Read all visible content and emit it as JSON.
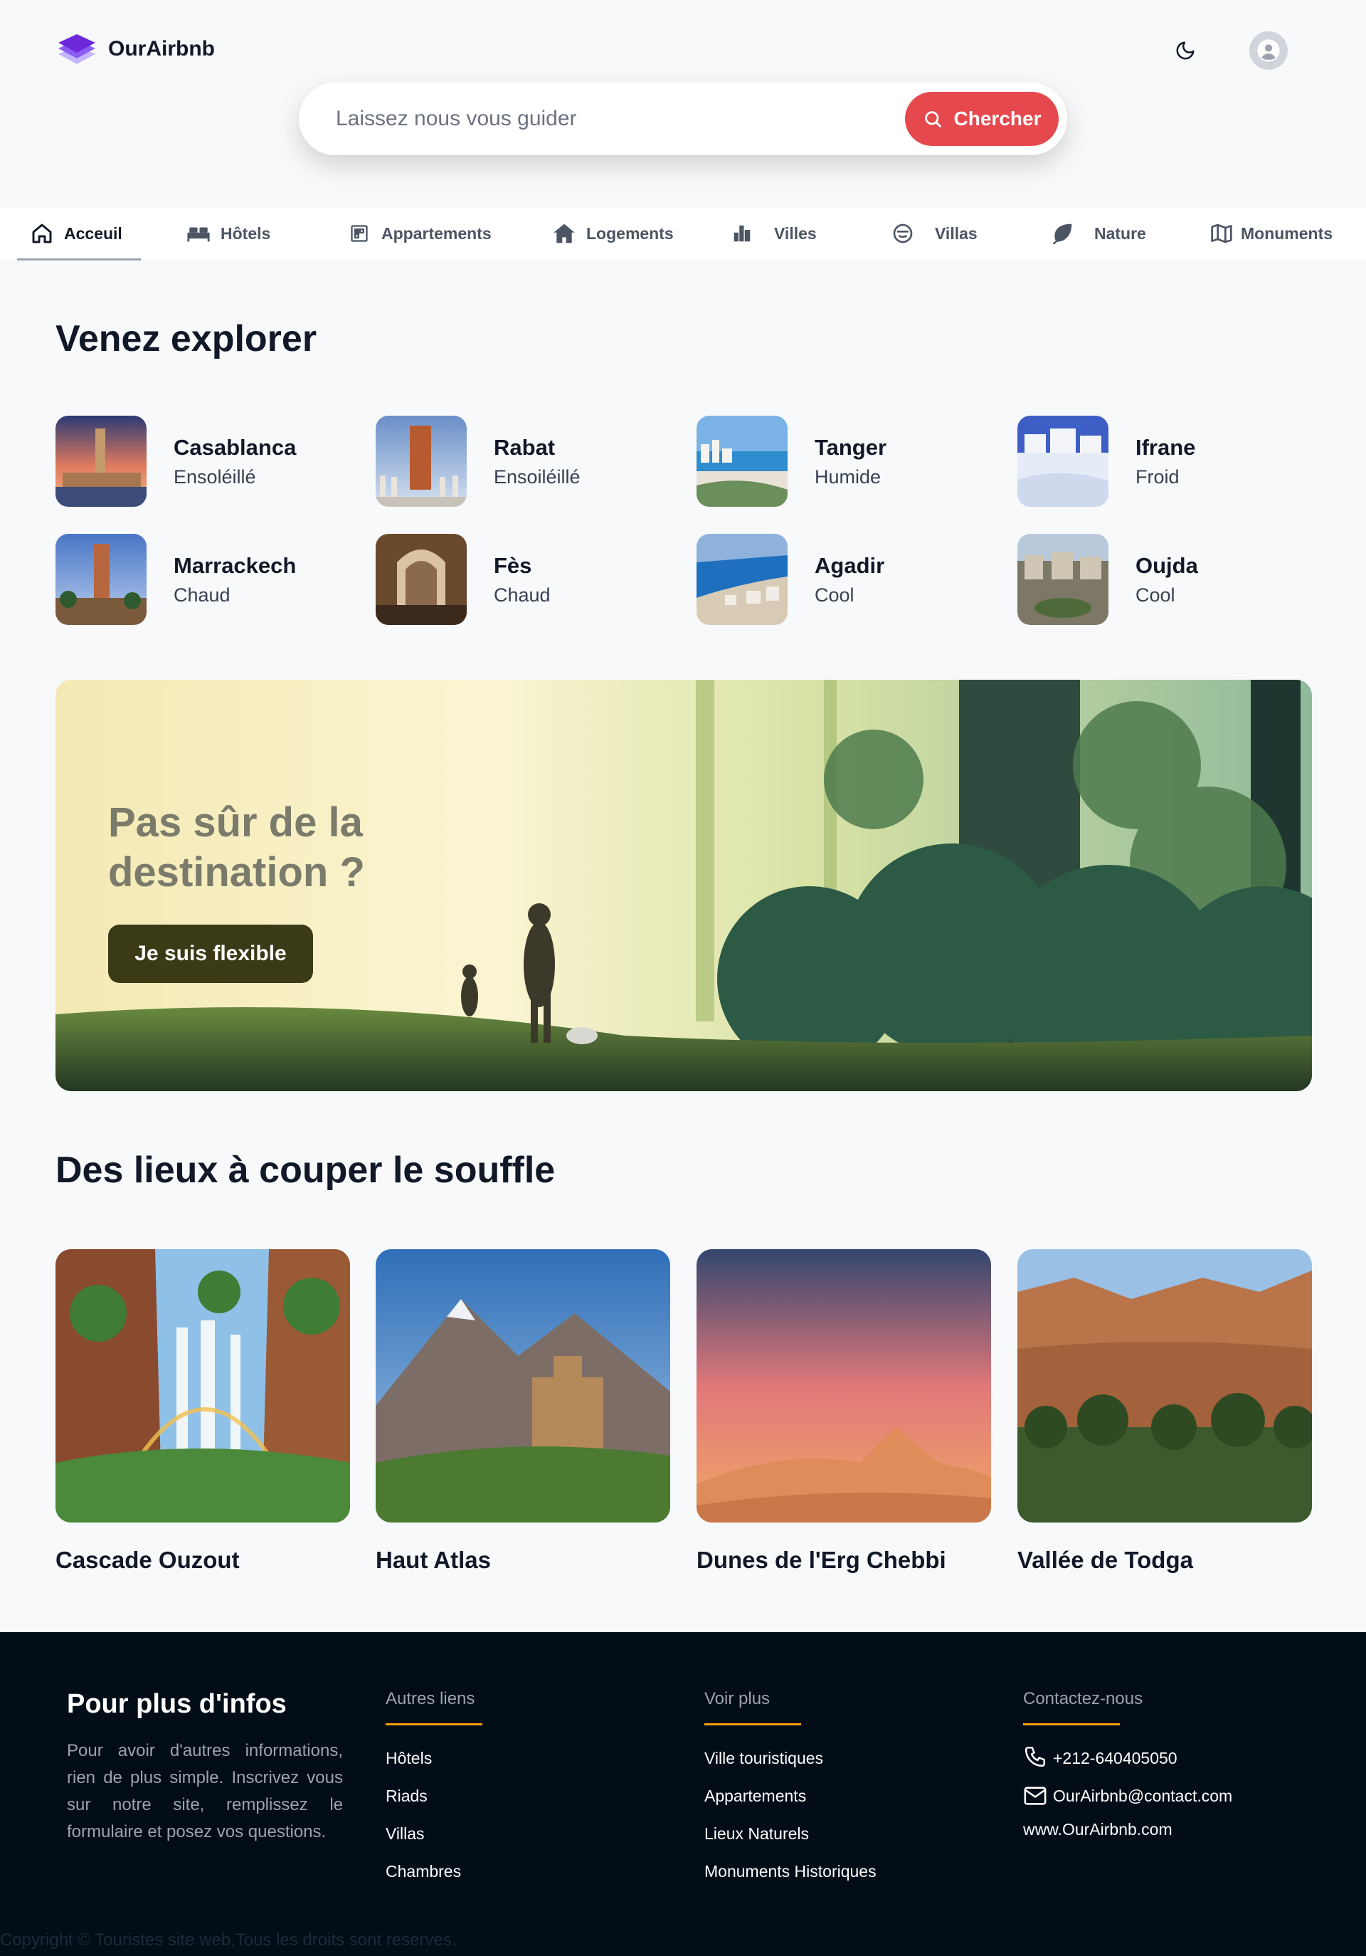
{
  "app": {
    "name": "OurAirbnb"
  },
  "search": {
    "placeholder": "Laissez nous vous guider",
    "button_label": "Chercher"
  },
  "categories": [
    {
      "label": "Acceuil",
      "icon": "home-icon",
      "active": true
    },
    {
      "label": "Hôtels",
      "icon": "bed-icon"
    },
    {
      "label": "Appartements",
      "icon": "apartment-icon"
    },
    {
      "label": "Logements",
      "icon": "house-icon"
    },
    {
      "label": "Villes",
      "icon": "city-icon"
    },
    {
      "label": "Villas",
      "icon": "villa-icon"
    },
    {
      "label": "Nature",
      "icon": "leaf-icon"
    },
    {
      "label": "Monuments",
      "icon": "map-icon"
    }
  ],
  "explore": {
    "title": "Venez explorer",
    "cities": [
      {
        "name": "Casablanca",
        "climate": "Ensoléillé"
      },
      {
        "name": "Rabat",
        "climate": "Ensoiléillé"
      },
      {
        "name": "Tanger",
        "climate": "Humide"
      },
      {
        "name": "Ifrane",
        "climate": "Froid"
      },
      {
        "name": "Marrackech",
        "climate": "Chaud"
      },
      {
        "name": "Fès",
        "climate": "Chaud"
      },
      {
        "name": "Agadir",
        "climate": "Cool"
      },
      {
        "name": "Oujda",
        "climate": "Cool"
      }
    ]
  },
  "banner": {
    "title": "Pas sûr de la destination ?",
    "button_label": "Je suis flexible"
  },
  "places": {
    "title": "Des lieux à couper le souffle",
    "items": [
      {
        "name": "Cascade Ouzout"
      },
      {
        "name": "Haut Atlas"
      },
      {
        "name": "Dunes de l'Erg Chebbi"
      },
      {
        "name": "Vallée de Todga"
      }
    ]
  },
  "footer": {
    "title": "Pour plus d'infos",
    "description": "Pour avoir d'autres informations, rien de plus simple. Inscrivez vous sur notre site, remplissez le formulaire et posez vos questions.",
    "other_links": {
      "title": "Autres liens",
      "items": [
        "Hôtels",
        "Riads",
        "Villas",
        "Chambres"
      ]
    },
    "see_more": {
      "title": "Voir plus",
      "items": [
        "Ville touristiques",
        "Appartements",
        "Lieux Naturels",
        "Monuments Historiques"
      ]
    },
    "contact": {
      "title": "Contactez-nous",
      "phone": "+212-640405050",
      "email": "OurAirbnb@contact.com",
      "website": "www.OurAirbnb.com"
    },
    "copyright": "Copyright © Touristes site web,Tous les droits sont reserves."
  },
  "colors": {
    "accent": "#e5484d",
    "footer_bg": "#020d17",
    "footer_underline": "#f59e0b",
    "banner_button": "#3a3a16"
  }
}
